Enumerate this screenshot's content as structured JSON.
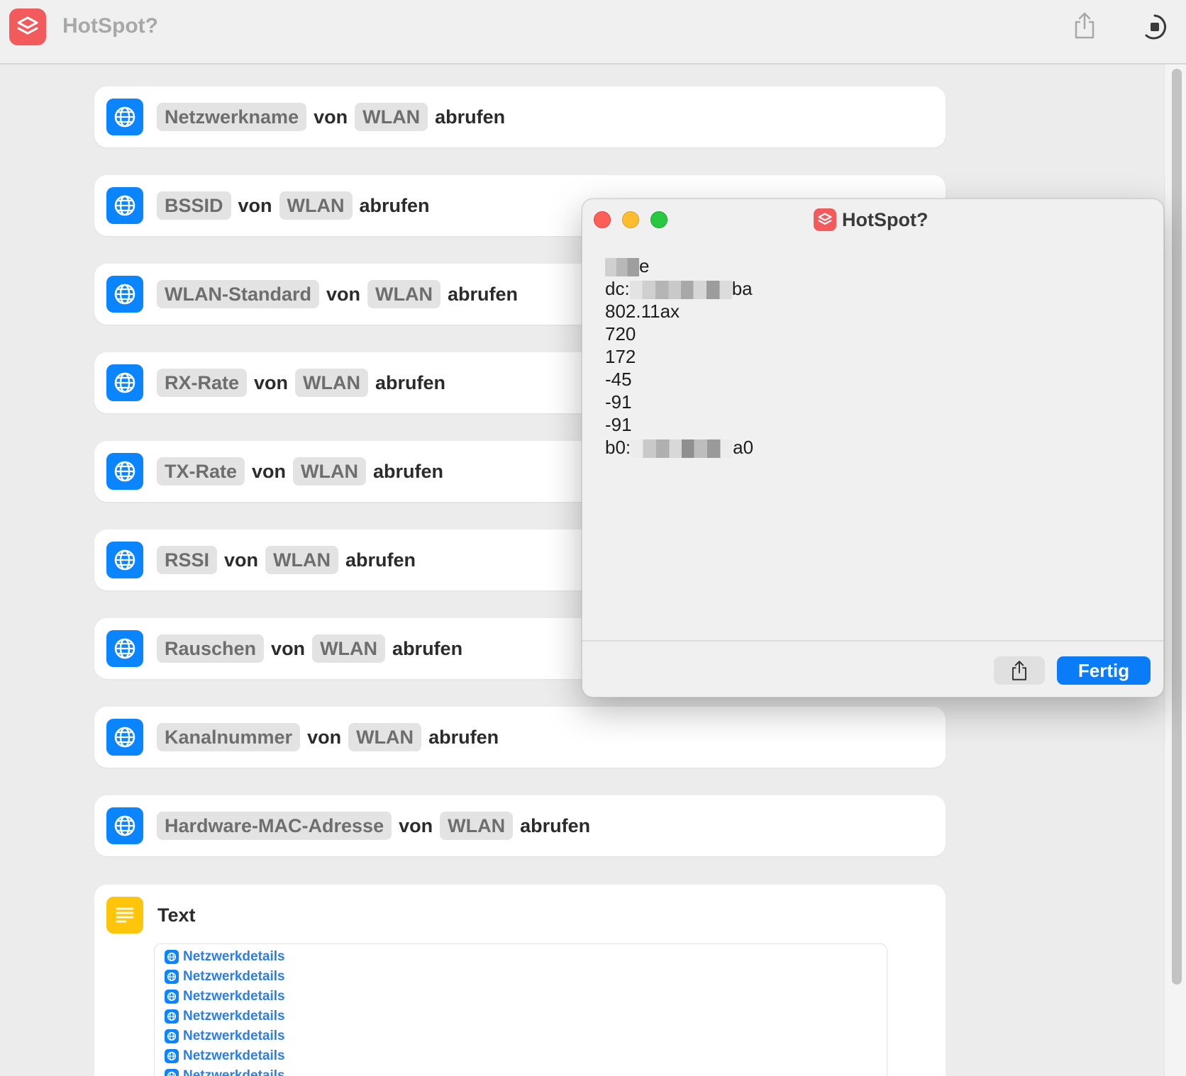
{
  "window": {
    "title": "HotSpot?"
  },
  "toolbar": {
    "share_icon": "share-icon",
    "run_icon": "run-icon"
  },
  "actions": [
    {
      "parameter": "Netzwerkname",
      "connector": "von",
      "source": "WLAN",
      "verb": "abrufen"
    },
    {
      "parameter": "BSSID",
      "connector": "von",
      "source": "WLAN",
      "verb": "abrufen"
    },
    {
      "parameter": "WLAN-Standard",
      "connector": "von",
      "source": "WLAN",
      "verb": "abrufen"
    },
    {
      "parameter": "RX-Rate",
      "connector": "von",
      "source": "WLAN",
      "verb": "abrufen"
    },
    {
      "parameter": "TX-Rate",
      "connector": "von",
      "source": "WLAN",
      "verb": "abrufen"
    },
    {
      "parameter": "RSSI",
      "connector": "von",
      "source": "WLAN",
      "verb": "abrufen"
    },
    {
      "parameter": "Rauschen",
      "connector": "von",
      "source": "WLAN",
      "verb": "abrufen"
    },
    {
      "parameter": "Kanalnummer",
      "connector": "von",
      "source": "WLAN",
      "verb": "abrufen"
    },
    {
      "parameter": "Hardware-MAC-Adresse",
      "connector": "von",
      "source": "WLAN",
      "verb": "abrufen"
    }
  ],
  "text_action": {
    "title": "Text",
    "variables": [
      "Netzwerkdetails",
      "Netzwerkdetails",
      "Netzwerkdetails",
      "Netzwerkdetails",
      "Netzwerkdetails",
      "Netzwerkdetails",
      "Netzwerkdetails"
    ]
  },
  "result_window": {
    "title": "HotSpot?",
    "lines": [
      {
        "prefix": "",
        "suffix": "e"
      },
      {
        "prefix": "dc:",
        "suffix": "ba"
      },
      {
        "prefix": "802.11ax",
        "suffix": ""
      },
      {
        "prefix": "720",
        "suffix": ""
      },
      {
        "prefix": "172",
        "suffix": ""
      },
      {
        "prefix": "-45",
        "suffix": ""
      },
      {
        "prefix": "-91",
        "suffix": ""
      },
      {
        "prefix": "-91",
        "suffix": ""
      },
      {
        "prefix": "b0:",
        "suffix": "a0"
      }
    ],
    "done_label": "Fertig"
  },
  "colors": {
    "accent": "#0a84ff",
    "app_icon": "#f25a5c",
    "text_icon": "#ffc50a",
    "variable_text": "#2b7de9"
  }
}
